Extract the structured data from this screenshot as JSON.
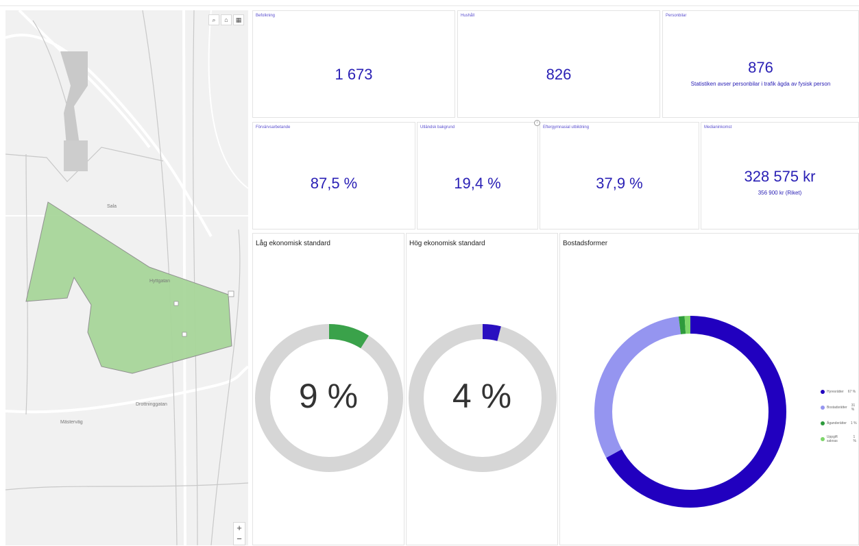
{
  "map": {
    "tools": [
      {
        "name": "search-icon",
        "glyph": "⌕"
      },
      {
        "name": "home-icon",
        "glyph": "⌂"
      },
      {
        "name": "qr-icon",
        "glyph": "▦"
      }
    ],
    "place_label": "Sala",
    "road_labels": [
      "Hyttgatan",
      "Mästerväg",
      "Drottninggatan"
    ],
    "zoom_in": "+",
    "zoom_out": "−",
    "area_color": "#a8d69a"
  },
  "kpis": {
    "population": {
      "title": "Befolkning",
      "value": "1 673"
    },
    "households": {
      "title": "Hushåll",
      "value": "826"
    },
    "cars": {
      "title": "Personbilar",
      "value": "876",
      "note": "Statistiken avser personbilar i trafik ägda av fysisk person"
    },
    "employment": {
      "title": "Förvärvsarbetande",
      "value": "87,5 %"
    },
    "foreign": {
      "title": "Utländsk bakgrund",
      "value": "19,4 %"
    },
    "education": {
      "title": "Eftergymnasial utbildning",
      "value": "37,9 %"
    },
    "income": {
      "title": "Medianinkomst",
      "value": "328 575 kr",
      "note": "356 900 kr (Riket)"
    }
  },
  "charts": {
    "low": {
      "title": "Låg ekonomisk standard",
      "label": "9 %",
      "percent": 9,
      "color": "#3aa24a",
      "track": "#d6d6d6"
    },
    "high": {
      "title": "Hög ekonomisk standard",
      "label": "4 %",
      "percent": 4,
      "color": "#2a10c0",
      "track": "#d6d6d6"
    },
    "housing": {
      "title": "Bostadsformer"
    }
  },
  "chart_data": {
    "type": "pie",
    "title": "Bostadsformer",
    "categories": [
      "Hyresrätter",
      "Bostadsrätter",
      "Äganderätter",
      "Uppgift saknas"
    ],
    "values": [
      67,
      31,
      1,
      1
    ],
    "labels": [
      "67 %",
      "31 %",
      "1 %",
      "1 %"
    ],
    "colors": [
      "#2100bf",
      "#9595f0",
      "#2e9b3c",
      "#7ed66b"
    ],
    "legend": "right"
  }
}
